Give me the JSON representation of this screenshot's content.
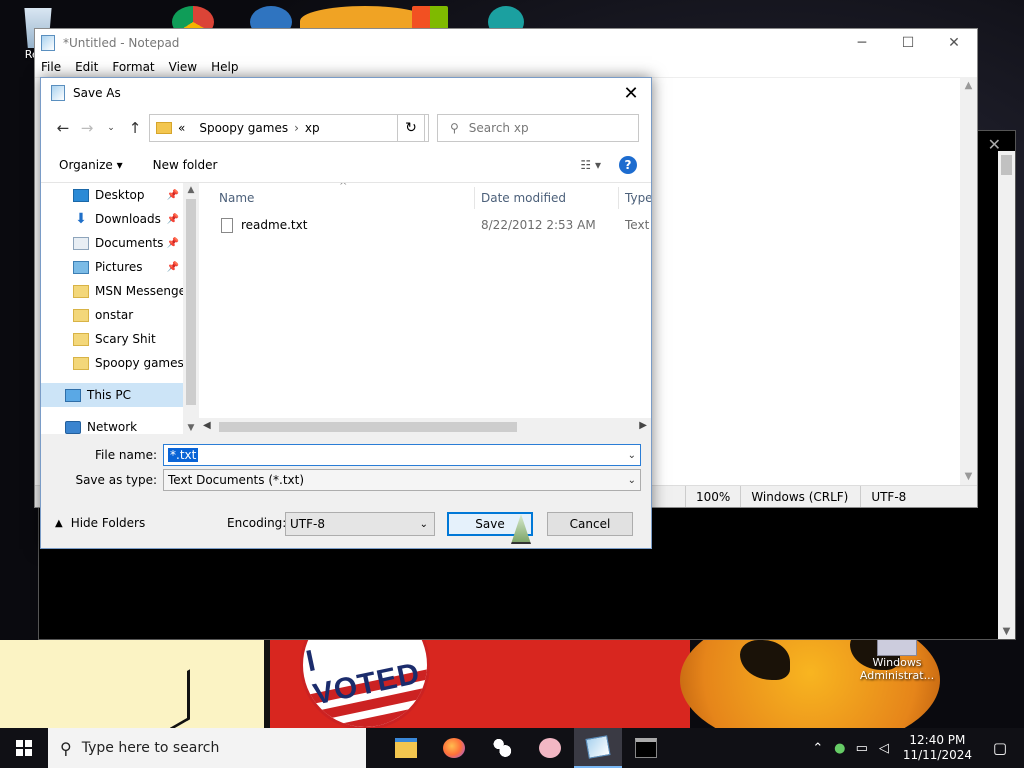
{
  "desktop": {
    "recycle_label": "Recy",
    "admin_label": "Windows Administrat...",
    "badge_text": "I VOTED"
  },
  "notepad": {
    "title": "*Untitled - Notepad",
    "menu": [
      "File",
      "Edit",
      "Format",
      "View",
      "Help"
    ],
    "status": {
      "zoom": "100%",
      "line_ending": "Windows (CRLF)",
      "encoding": "UTF-8"
    }
  },
  "dialog": {
    "title": "Save As",
    "address": {
      "overflow": "«",
      "path": [
        "Spoopy games",
        "xp"
      ]
    },
    "search_placeholder": "Search xp",
    "toolbar": {
      "organize": "Organize",
      "new_folder": "New folder"
    },
    "nav_items": [
      {
        "label": "Desktop",
        "icon": "desktop-icon",
        "pinned": true
      },
      {
        "label": "Downloads",
        "icon": "download-icon",
        "pinned": true
      },
      {
        "label": "Documents",
        "icon": "documents-icon",
        "pinned": true
      },
      {
        "label": "Pictures",
        "icon": "pictures-icon",
        "pinned": true
      },
      {
        "label": "MSN Messenger",
        "icon": "folder-icon",
        "pinned": false
      },
      {
        "label": "onstar",
        "icon": "folder-icon",
        "pinned": false
      },
      {
        "label": "Scary Shit",
        "icon": "folder-icon",
        "pinned": false
      },
      {
        "label": "Spoopy games",
        "icon": "folder-icon",
        "pinned": false
      },
      {
        "label": "This PC",
        "icon": "pc-icon",
        "pinned": false
      },
      {
        "label": "Network",
        "icon": "network-icon",
        "pinned": false
      }
    ],
    "columns": {
      "name": "Name",
      "date": "Date modified",
      "type": "Type"
    },
    "files": [
      {
        "name": "readme.txt",
        "date": "8/22/2012 2:53 AM",
        "type": "Text D"
      }
    ],
    "file_name_label": "File name:",
    "file_name_value": "*.txt",
    "save_type_label": "Save as type:",
    "save_type_value": "Text Documents (*.txt)",
    "hide_folders": "Hide Folders",
    "encoding_label": "Encoding:",
    "encoding_value": "UTF-8",
    "save_button": "Save",
    "cancel_button": "Cancel"
  },
  "taskbar": {
    "search_placeholder": "Type here to search",
    "time": "12:40 PM",
    "date": "11/11/2024"
  },
  "colors": {
    "accent": "#0078d7",
    "selection": "#0a64d6",
    "nav_selected": "#cce4f7"
  }
}
